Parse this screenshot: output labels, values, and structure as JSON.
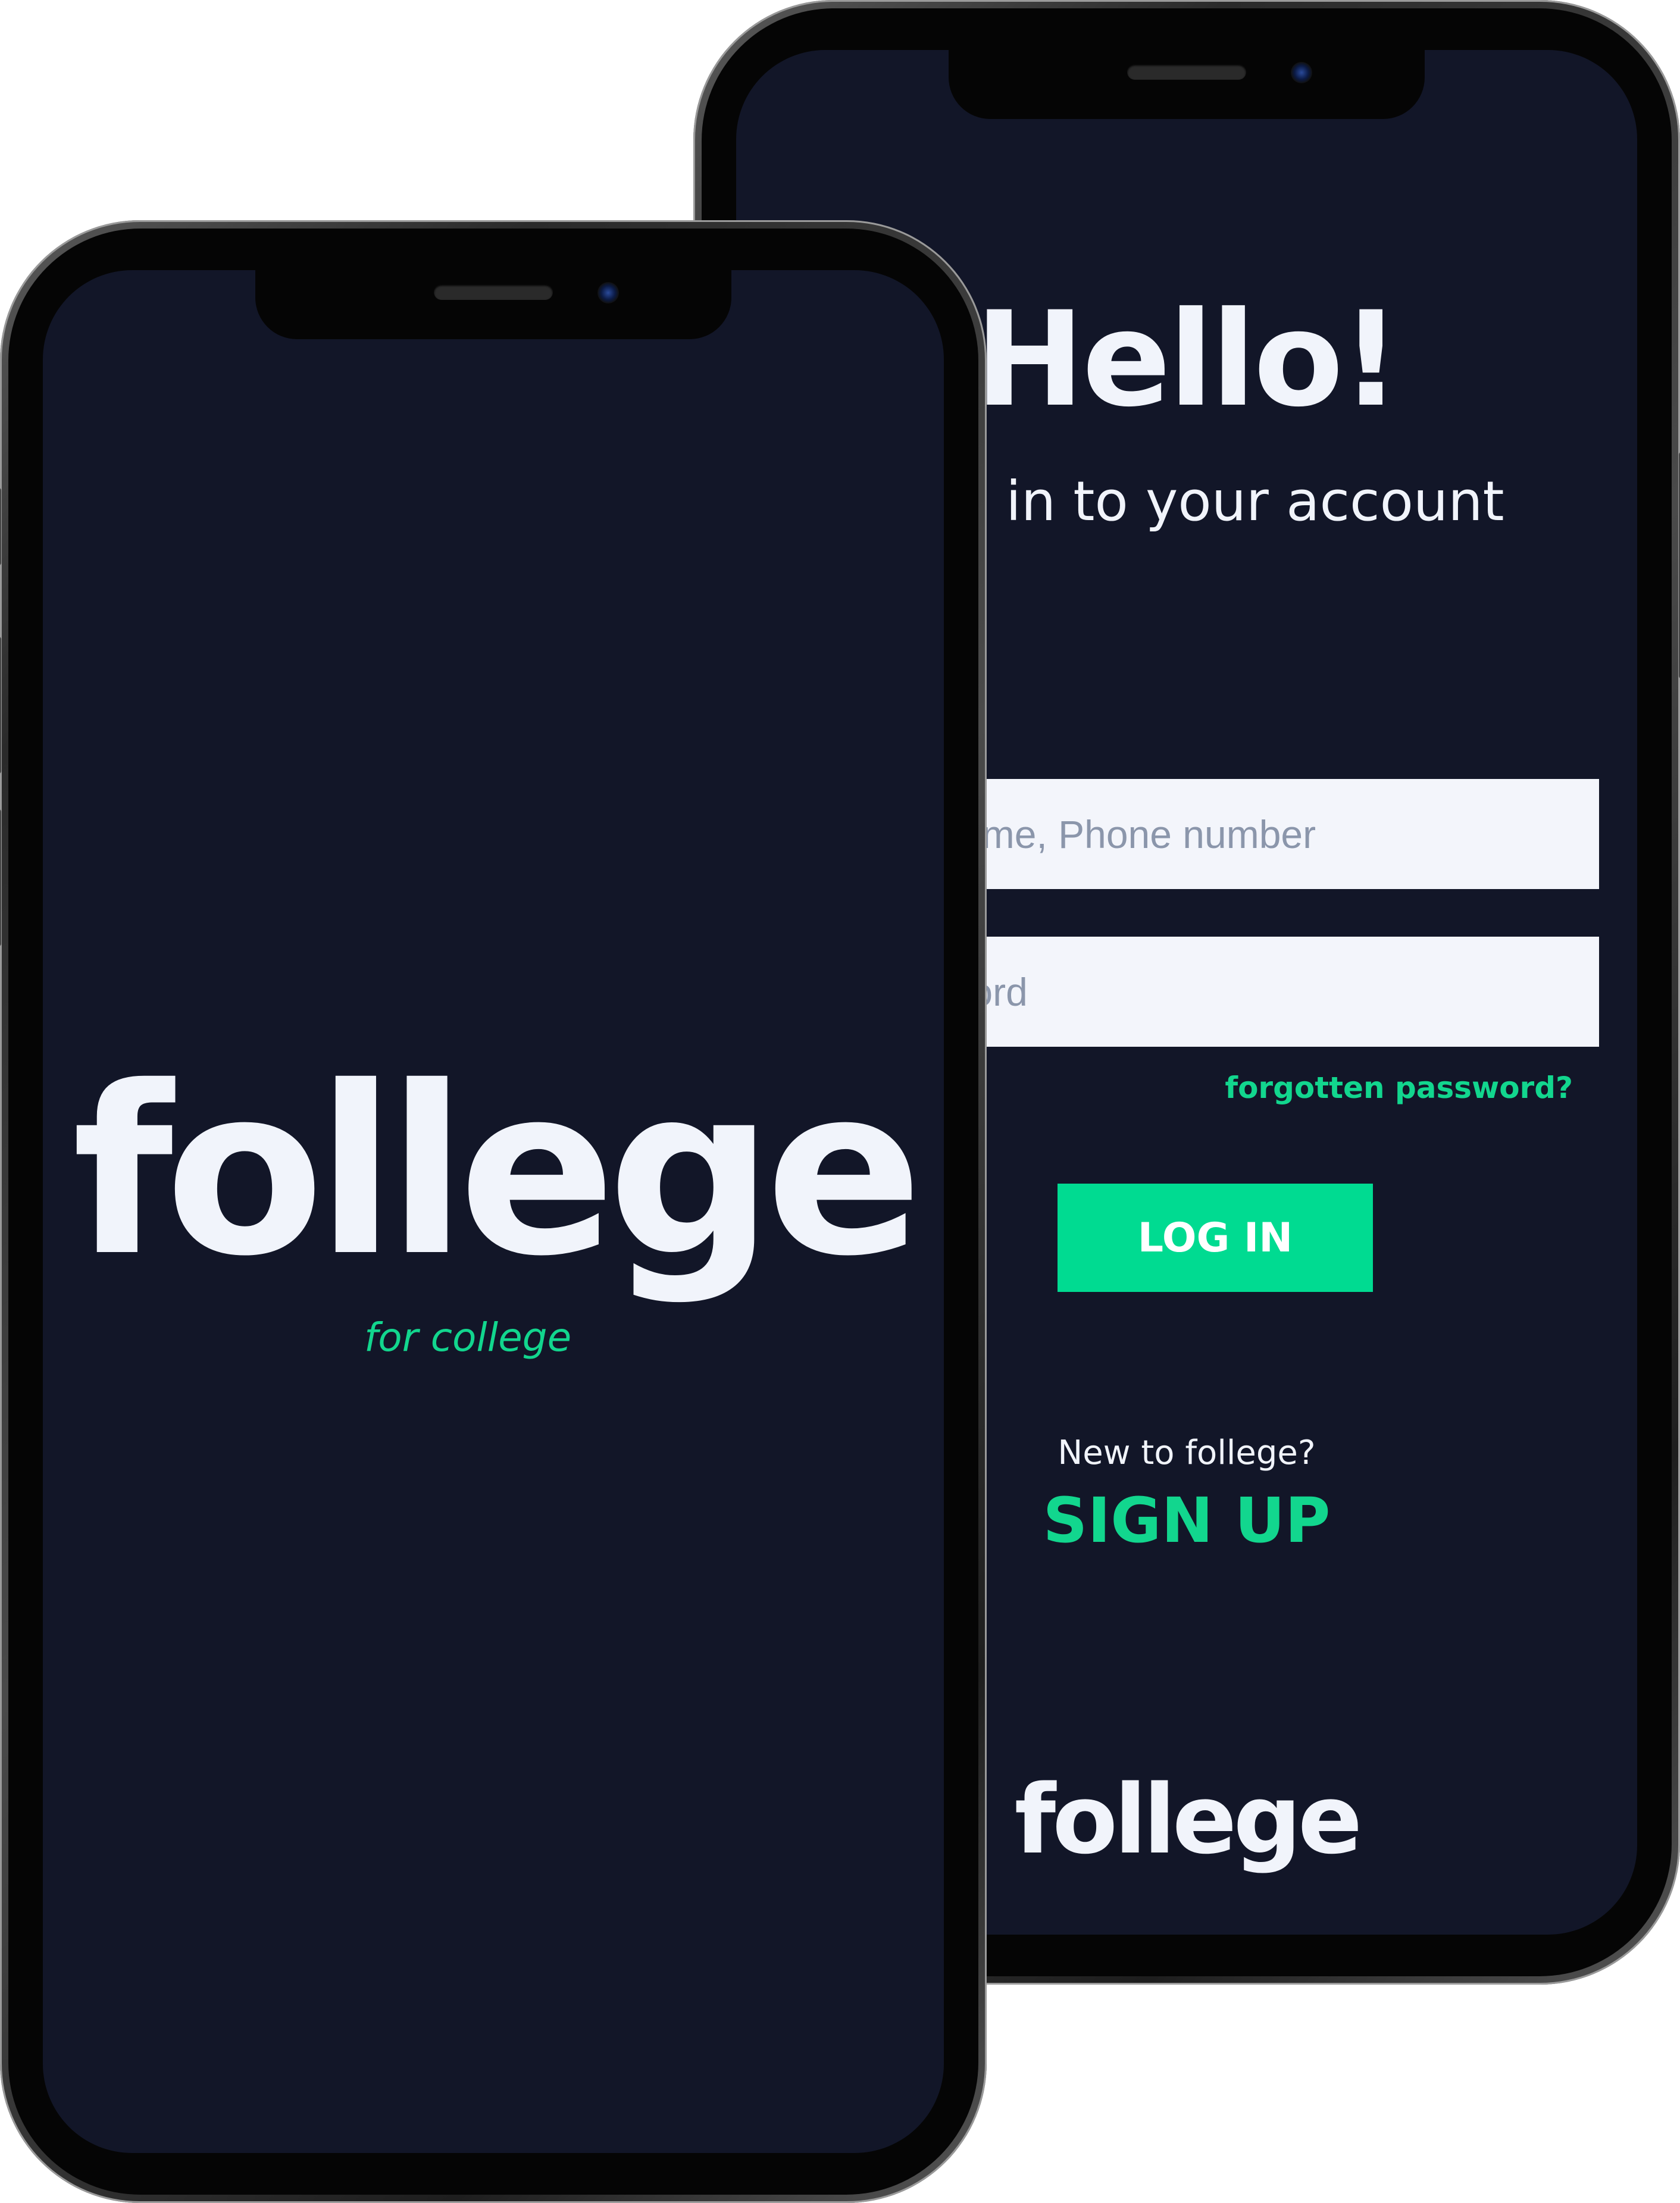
{
  "colors": {
    "background": "#121628",
    "accent": "#12d68e",
    "button": "#00db91",
    "text": "#f1f4fb",
    "field": "#f3f5fb",
    "placeholder": "#8b96ab"
  },
  "splash": {
    "logo": "follege",
    "tagline": "for college"
  },
  "login": {
    "title": "Hello!",
    "subtitle": "Sign in to your account",
    "username_placeholder": "Username, Phone number",
    "password_placeholder": "Password",
    "forgot_label": "forgotten password?",
    "login_button": "LOG IN",
    "new_prompt": "New to follege?",
    "signup_label": "SIGN UP",
    "logo": "follege"
  }
}
